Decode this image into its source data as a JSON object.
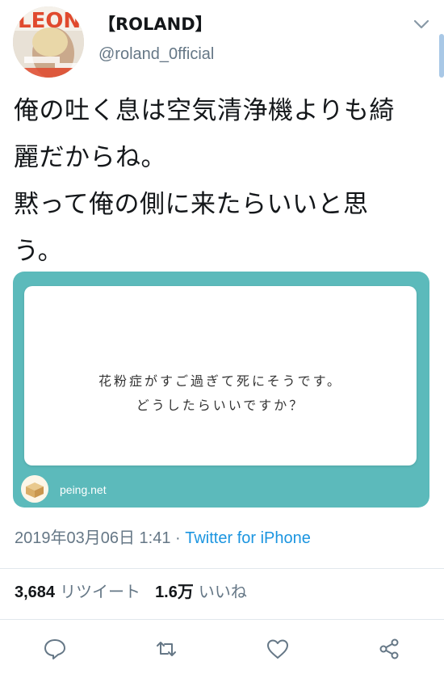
{
  "user": {
    "display_name": "【ROLAND】",
    "handle": "@roland_0fficial"
  },
  "tweet": {
    "lines": [
      "俺の吐く息は空気清浄機よりも綺",
      "麗だからね。",
      "黙って俺の側に来たらいいと思",
      "う。"
    ]
  },
  "card": {
    "question_lines": [
      "花粉症がすご過ぎて死にそうです。",
      "どうしたらいいですか？"
    ],
    "domain": "peing.net",
    "background_color": "#5cbabb"
  },
  "meta": {
    "timestamp": "2019年03月06日 1:41",
    "separator": " · ",
    "source": "Twitter for iPhone",
    "source_color": "#1b95e0"
  },
  "stats": {
    "retweets_count": "3,684",
    "retweets_label": "リツイート",
    "likes_count": "1.6万",
    "likes_label": "いいね"
  },
  "actions": {
    "icons": [
      "reply-icon",
      "retweet-icon",
      "like-icon",
      "share-icon"
    ]
  }
}
